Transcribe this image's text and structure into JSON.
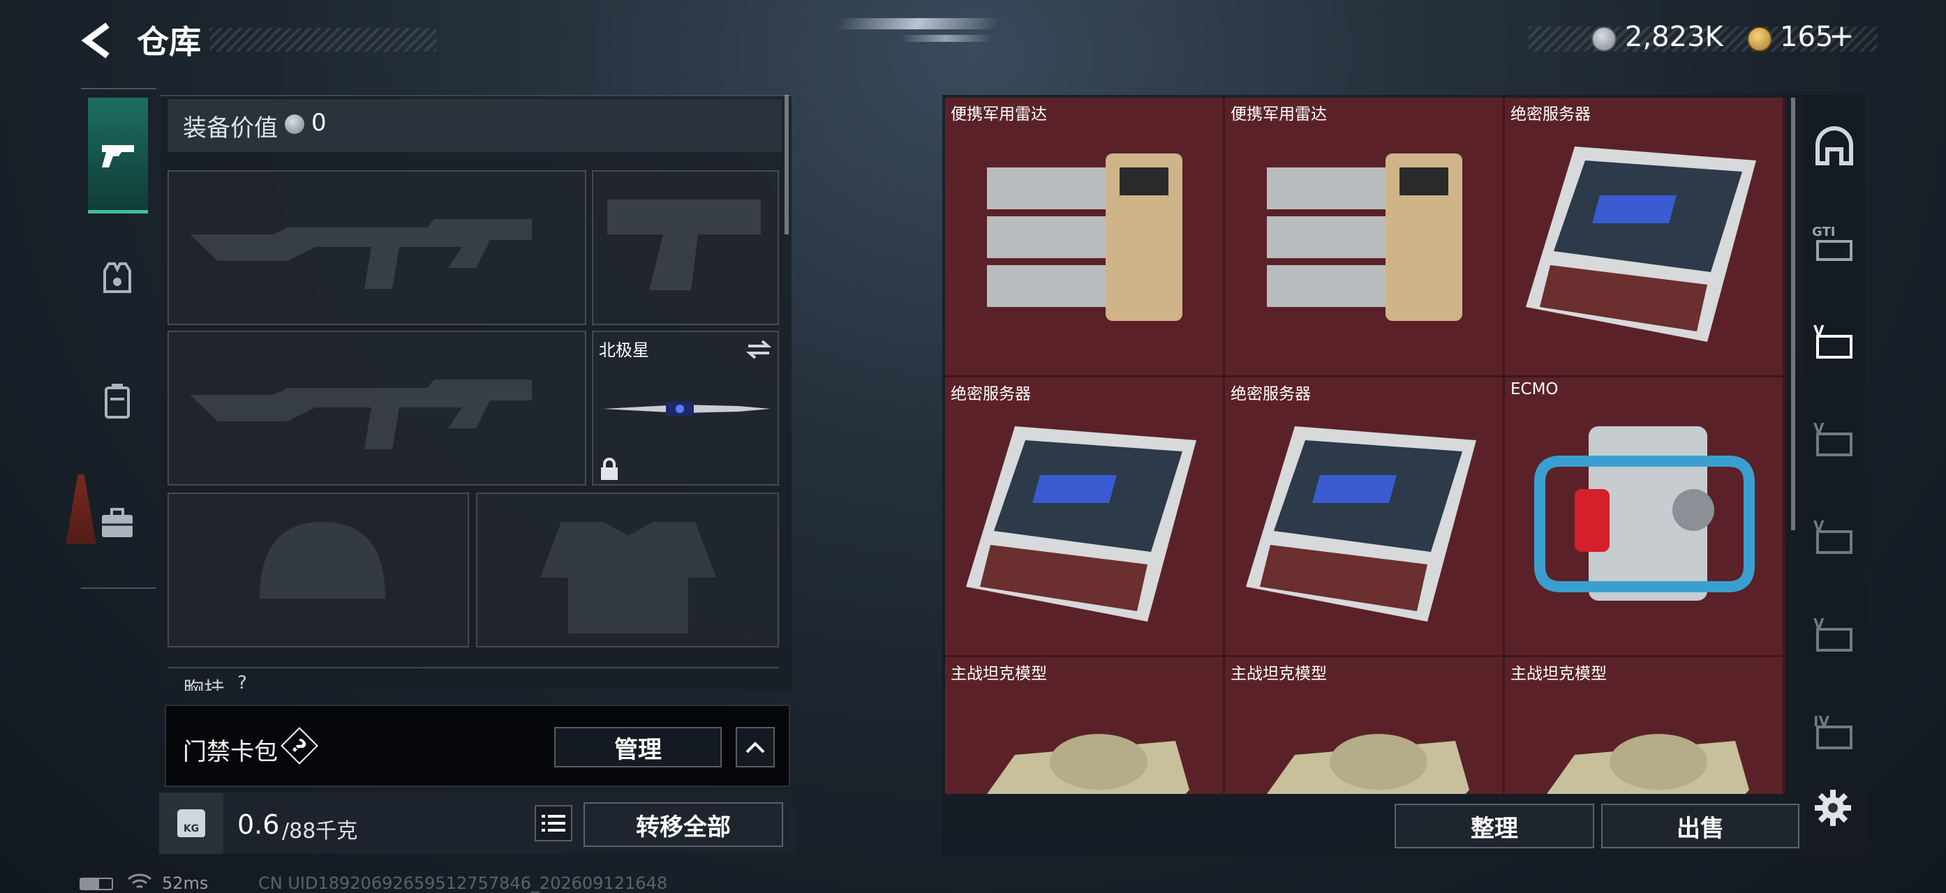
{
  "header": {
    "title": "仓库",
    "currency_value": "2,823K",
    "coupon_value": "165",
    "coupon_plus": "+"
  },
  "equipment": {
    "value_label": "装备价值",
    "value_amount": "0",
    "melee_name": "北极星",
    "chest_rig_label": "胸挂",
    "chest_rig_hint": "?"
  },
  "keycard_bar": {
    "label": "门禁卡包",
    "help": "?",
    "manage_label": "管理"
  },
  "capacity": {
    "kg_badge": "KG",
    "current": "0.6",
    "maximum": "/88千克",
    "transfer_all_label": "转移全部"
  },
  "stash": {
    "items": [
      {
        "name": "便携军用雷达",
        "kind": "radar"
      },
      {
        "name": "便携军用雷达",
        "kind": "radar"
      },
      {
        "name": "绝密服务器",
        "kind": "server"
      },
      {
        "name": "绝密服务器",
        "kind": "server"
      },
      {
        "name": "绝密服务器",
        "kind": "server"
      },
      {
        "name": "ECMO",
        "kind": "ecmo"
      },
      {
        "name": "主战坦克模型",
        "kind": "tank"
      },
      {
        "name": "主战坦克模型",
        "kind": "tank"
      },
      {
        "name": "主战坦克模型",
        "kind": "tank"
      }
    ],
    "sort_label": "整理",
    "sell_label": "出售"
  },
  "right_tabs": {
    "tab2_label": "GTI",
    "tab3_label": "V",
    "tab4_label": "V",
    "tab5_label": "V",
    "tab6_label": "V",
    "tab7_label": "IV"
  },
  "status_bar": {
    "ping": "52ms",
    "uid": "CN UID18920692659512757846_202609121648"
  },
  "colors": {
    "stash_cell": "#5a2228",
    "active_tab_accent": "#3fbf9a",
    "panel": "#181e26"
  }
}
